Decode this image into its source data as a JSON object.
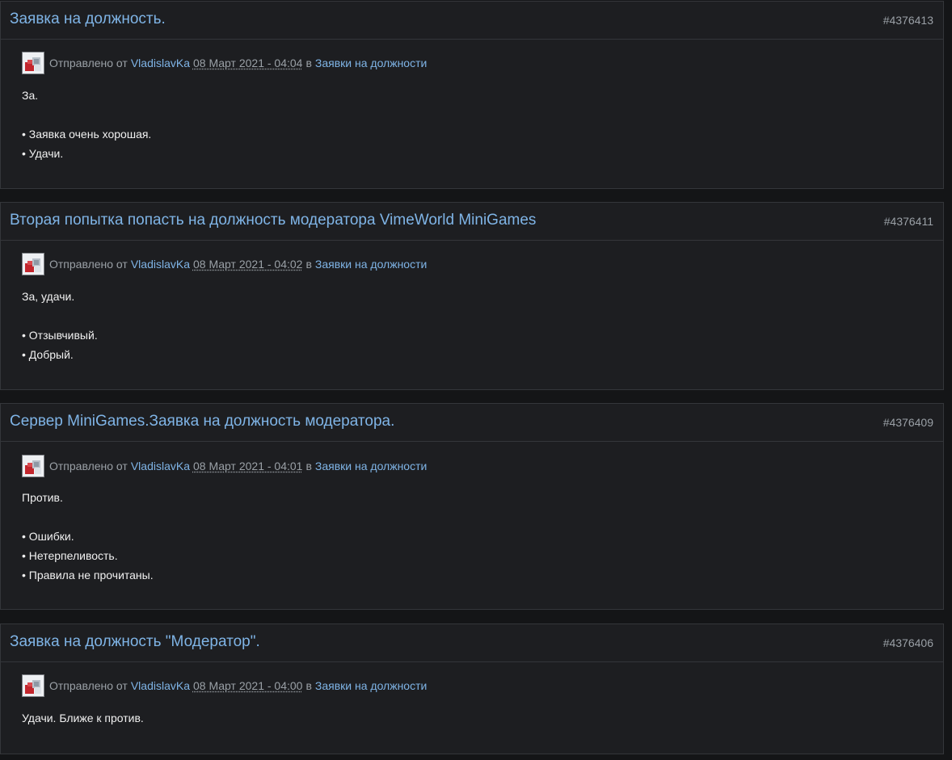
{
  "labels": {
    "sent_by": "Отправлено от",
    "in": "в"
  },
  "posts": [
    {
      "title": "Заявка на должность.",
      "id": "#4376413",
      "author": "VladislavKa",
      "date": "08 Март 2021 - 04:04",
      "forum": "Заявки на должности",
      "lines": [
        "За.",
        "",
        "• Заявка очень хорошая.",
        "• Удачи."
      ]
    },
    {
      "title": "Вторая попытка попасть на должность модератора VimeWorld MiniGames",
      "id": "#4376411",
      "author": "VladislavKa",
      "date": "08 Март 2021 - 04:02",
      "forum": "Заявки на должности",
      "lines": [
        "За, удачи.",
        "",
        "• Отзывчивый.",
        "• Добрый."
      ]
    },
    {
      "title": "Сервер MiniGames.Заявка на должность модератора.",
      "id": "#4376409",
      "author": "VladislavKa",
      "date": "08 Март 2021 - 04:01",
      "forum": "Заявки на должности",
      "lines": [
        "Против.",
        "",
        "• Ошибки.",
        "• Нетерпеливость.",
        "• Правила не прочитаны."
      ]
    },
    {
      "title": "Заявка на должность \"Модератор\".",
      "id": "#4376406",
      "author": "VladislavKa",
      "date": "08 Март 2021 - 04:00",
      "forum": "Заявки на должности",
      "lines": [
        "Удачи. Ближе к против."
      ]
    }
  ]
}
